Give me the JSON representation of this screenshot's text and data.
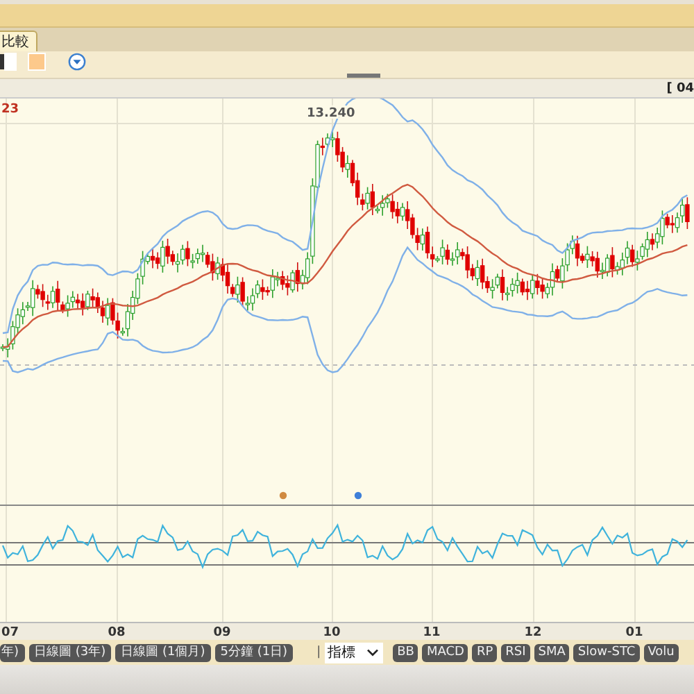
{
  "tabs": [
    {
      "label": "比較",
      "selected": true
    }
  ],
  "chart": {
    "range_label": "[ 04",
    "low_label": "23",
    "peak_label": "13.240",
    "markers": [
      {
        "color": "#d08a40"
      },
      {
        "color": "#3f7fd8"
      }
    ],
    "x_labels": [
      "07",
      "08",
      "09",
      "10",
      "11",
      "12",
      "01"
    ]
  },
  "periods": [
    "年)",
    "日線圖 (3年)",
    "日線圖 (1個月)",
    "5分鐘 (1日)"
  ],
  "separator": "|",
  "indicator_select": {
    "value": "指標"
  },
  "indicators": [
    "BB",
    "MACD",
    "RP",
    "RSI",
    "SMA",
    "Slow-STC",
    "Volu"
  ]
}
